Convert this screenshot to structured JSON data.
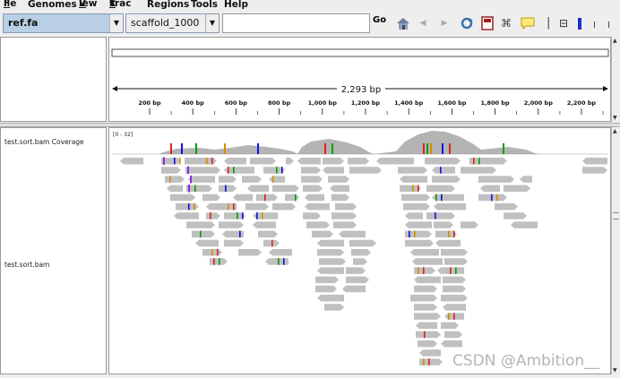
{
  "menu": [
    {
      "pre": "",
      "u": "F",
      "post": "ile"
    },
    {
      "pre": "Genomes",
      "u": "",
      "post": ""
    },
    {
      "pre": "",
      "u": "V",
      "post": "iew"
    },
    {
      "pre": "Trac",
      "u": "k",
      "post": "s"
    },
    {
      "pre": "Regions",
      "u": "",
      "post": ""
    },
    {
      "pre": "Tools",
      "u": "",
      "post": ""
    },
    {
      "pre": "Help",
      "u": "",
      "post": ""
    }
  ],
  "toolbar": {
    "genome": "ref.fa",
    "chromosome": "scaffold_1000",
    "locus_value": "",
    "go_label": "Go"
  },
  "ruler": {
    "span_label": "2,293 bp",
    "ticks": [
      "200 bp",
      "400 bp",
      "600 bp",
      "800 bp",
      "1,000 bp",
      "1,200 bp",
      "1,400 bp",
      "1,600 bp",
      "1,800 bp",
      "2,000 bp",
      "2,200 bp"
    ]
  },
  "tracks": {
    "coverage_label": "test.sort.bam Coverage",
    "coverage_range": "[0 - 32]",
    "alignment_label": "test.sort.bam"
  },
  "watermark": "CSDN @Ambition__",
  "colors": {
    "read_fill": "#c0c0c0",
    "genome_combo": "#b8cfe5",
    "mismatch_A": "#00a000",
    "mismatch_C": "#1010e0",
    "mismatch_G": "#d09000",
    "mismatch_T": "#e02020",
    "insertion": "#8a2be2",
    "coverage_fill": "#b4b4b4"
  }
}
